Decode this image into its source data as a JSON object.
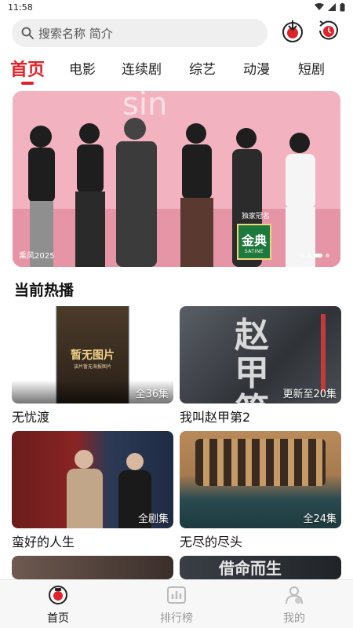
{
  "status_bar": {
    "time": "11:58"
  },
  "search": {
    "placeholder": "搜索名称 简介"
  },
  "tabs": [
    {
      "label": "首页",
      "active": true
    },
    {
      "label": "电影"
    },
    {
      "label": "连续剧"
    },
    {
      "label": "综艺"
    },
    {
      "label": "动漫"
    },
    {
      "label": "短剧"
    }
  ],
  "banner": {
    "caption": "乘风2025",
    "sponsor_label": "独家冠名",
    "sponsor_logo_text": "金典",
    "sponsor_logo_sub": "SATINE"
  },
  "section": {
    "title": "当前热播"
  },
  "cards": [
    {
      "title": "无忧渡",
      "badge": "全36集",
      "poster_text": "暂无图片",
      "poster_sub": "该片暂无海报图片"
    },
    {
      "title": "我叫赵甲第2",
      "badge": "更新至20集",
      "poster_text": "赵甲第"
    },
    {
      "title": "蛮好的人生",
      "badge": "全剧集"
    },
    {
      "title": "无尽的尽头",
      "badge": "全24集"
    },
    {
      "title": "",
      "badge": ""
    },
    {
      "title": "",
      "badge": "",
      "poster_text": "借命而生"
    }
  ],
  "bottom_nav": [
    {
      "label": "首页",
      "active": true
    },
    {
      "label": "排行榜"
    },
    {
      "label": "我的"
    }
  ],
  "colors": {
    "accent": "#e0232b",
    "muted": "#999999"
  }
}
